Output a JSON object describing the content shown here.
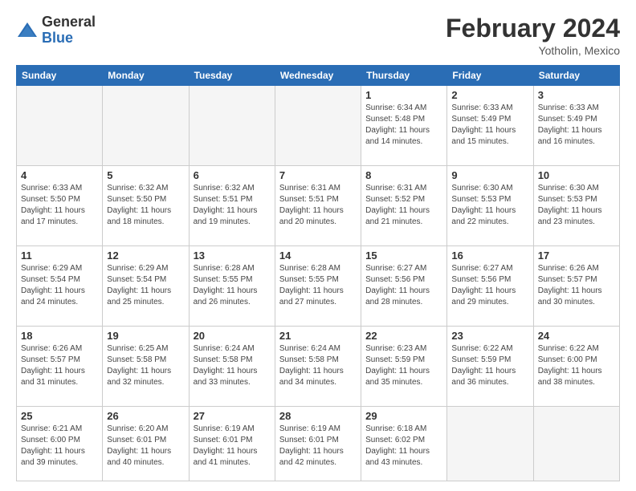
{
  "header": {
    "logo_general": "General",
    "logo_blue": "Blue",
    "title": "February 2024",
    "subtitle": "Yotholin, Mexico"
  },
  "weekdays": [
    "Sunday",
    "Monday",
    "Tuesday",
    "Wednesday",
    "Thursday",
    "Friday",
    "Saturday"
  ],
  "weeks": [
    [
      {
        "day": "",
        "sunrise": "",
        "sunset": "",
        "daylight": "",
        "empty": true
      },
      {
        "day": "",
        "sunrise": "",
        "sunset": "",
        "daylight": "",
        "empty": true
      },
      {
        "day": "",
        "sunrise": "",
        "sunset": "",
        "daylight": "",
        "empty": true
      },
      {
        "day": "",
        "sunrise": "",
        "sunset": "",
        "daylight": "",
        "empty": true
      },
      {
        "day": "1",
        "sunrise": "Sunrise: 6:34 AM",
        "sunset": "Sunset: 5:48 PM",
        "daylight": "Daylight: 11 hours and 14 minutes.",
        "empty": false
      },
      {
        "day": "2",
        "sunrise": "Sunrise: 6:33 AM",
        "sunset": "Sunset: 5:49 PM",
        "daylight": "Daylight: 11 hours and 15 minutes.",
        "empty": false
      },
      {
        "day": "3",
        "sunrise": "Sunrise: 6:33 AM",
        "sunset": "Sunset: 5:49 PM",
        "daylight": "Daylight: 11 hours and 16 minutes.",
        "empty": false
      }
    ],
    [
      {
        "day": "4",
        "sunrise": "Sunrise: 6:33 AM",
        "sunset": "Sunset: 5:50 PM",
        "daylight": "Daylight: 11 hours and 17 minutes.",
        "empty": false
      },
      {
        "day": "5",
        "sunrise": "Sunrise: 6:32 AM",
        "sunset": "Sunset: 5:50 PM",
        "daylight": "Daylight: 11 hours and 18 minutes.",
        "empty": false
      },
      {
        "day": "6",
        "sunrise": "Sunrise: 6:32 AM",
        "sunset": "Sunset: 5:51 PM",
        "daylight": "Daylight: 11 hours and 19 minutes.",
        "empty": false
      },
      {
        "day": "7",
        "sunrise": "Sunrise: 6:31 AM",
        "sunset": "Sunset: 5:51 PM",
        "daylight": "Daylight: 11 hours and 20 minutes.",
        "empty": false
      },
      {
        "day": "8",
        "sunrise": "Sunrise: 6:31 AM",
        "sunset": "Sunset: 5:52 PM",
        "daylight": "Daylight: 11 hours and 21 minutes.",
        "empty": false
      },
      {
        "day": "9",
        "sunrise": "Sunrise: 6:30 AM",
        "sunset": "Sunset: 5:53 PM",
        "daylight": "Daylight: 11 hours and 22 minutes.",
        "empty": false
      },
      {
        "day": "10",
        "sunrise": "Sunrise: 6:30 AM",
        "sunset": "Sunset: 5:53 PM",
        "daylight": "Daylight: 11 hours and 23 minutes.",
        "empty": false
      }
    ],
    [
      {
        "day": "11",
        "sunrise": "Sunrise: 6:29 AM",
        "sunset": "Sunset: 5:54 PM",
        "daylight": "Daylight: 11 hours and 24 minutes.",
        "empty": false
      },
      {
        "day": "12",
        "sunrise": "Sunrise: 6:29 AM",
        "sunset": "Sunset: 5:54 PM",
        "daylight": "Daylight: 11 hours and 25 minutes.",
        "empty": false
      },
      {
        "day": "13",
        "sunrise": "Sunrise: 6:28 AM",
        "sunset": "Sunset: 5:55 PM",
        "daylight": "Daylight: 11 hours and 26 minutes.",
        "empty": false
      },
      {
        "day": "14",
        "sunrise": "Sunrise: 6:28 AM",
        "sunset": "Sunset: 5:55 PM",
        "daylight": "Daylight: 11 hours and 27 minutes.",
        "empty": false
      },
      {
        "day": "15",
        "sunrise": "Sunrise: 6:27 AM",
        "sunset": "Sunset: 5:56 PM",
        "daylight": "Daylight: 11 hours and 28 minutes.",
        "empty": false
      },
      {
        "day": "16",
        "sunrise": "Sunrise: 6:27 AM",
        "sunset": "Sunset: 5:56 PM",
        "daylight": "Daylight: 11 hours and 29 minutes.",
        "empty": false
      },
      {
        "day": "17",
        "sunrise": "Sunrise: 6:26 AM",
        "sunset": "Sunset: 5:57 PM",
        "daylight": "Daylight: 11 hours and 30 minutes.",
        "empty": false
      }
    ],
    [
      {
        "day": "18",
        "sunrise": "Sunrise: 6:26 AM",
        "sunset": "Sunset: 5:57 PM",
        "daylight": "Daylight: 11 hours and 31 minutes.",
        "empty": false
      },
      {
        "day": "19",
        "sunrise": "Sunrise: 6:25 AM",
        "sunset": "Sunset: 5:58 PM",
        "daylight": "Daylight: 11 hours and 32 minutes.",
        "empty": false
      },
      {
        "day": "20",
        "sunrise": "Sunrise: 6:24 AM",
        "sunset": "Sunset: 5:58 PM",
        "daylight": "Daylight: 11 hours and 33 minutes.",
        "empty": false
      },
      {
        "day": "21",
        "sunrise": "Sunrise: 6:24 AM",
        "sunset": "Sunset: 5:58 PM",
        "daylight": "Daylight: 11 hours and 34 minutes.",
        "empty": false
      },
      {
        "day": "22",
        "sunrise": "Sunrise: 6:23 AM",
        "sunset": "Sunset: 5:59 PM",
        "daylight": "Daylight: 11 hours and 35 minutes.",
        "empty": false
      },
      {
        "day": "23",
        "sunrise": "Sunrise: 6:22 AM",
        "sunset": "Sunset: 5:59 PM",
        "daylight": "Daylight: 11 hours and 36 minutes.",
        "empty": false
      },
      {
        "day": "24",
        "sunrise": "Sunrise: 6:22 AM",
        "sunset": "Sunset: 6:00 PM",
        "daylight": "Daylight: 11 hours and 38 minutes.",
        "empty": false
      }
    ],
    [
      {
        "day": "25",
        "sunrise": "Sunrise: 6:21 AM",
        "sunset": "Sunset: 6:00 PM",
        "daylight": "Daylight: 11 hours and 39 minutes.",
        "empty": false
      },
      {
        "day": "26",
        "sunrise": "Sunrise: 6:20 AM",
        "sunset": "Sunset: 6:01 PM",
        "daylight": "Daylight: 11 hours and 40 minutes.",
        "empty": false
      },
      {
        "day": "27",
        "sunrise": "Sunrise: 6:19 AM",
        "sunset": "Sunset: 6:01 PM",
        "daylight": "Daylight: 11 hours and 41 minutes.",
        "empty": false
      },
      {
        "day": "28",
        "sunrise": "Sunrise: 6:19 AM",
        "sunset": "Sunset: 6:01 PM",
        "daylight": "Daylight: 11 hours and 42 minutes.",
        "empty": false
      },
      {
        "day": "29",
        "sunrise": "Sunrise: 6:18 AM",
        "sunset": "Sunset: 6:02 PM",
        "daylight": "Daylight: 11 hours and 43 minutes.",
        "empty": false
      },
      {
        "day": "",
        "sunrise": "",
        "sunset": "",
        "daylight": "",
        "empty": true
      },
      {
        "day": "",
        "sunrise": "",
        "sunset": "",
        "daylight": "",
        "empty": true
      }
    ]
  ]
}
